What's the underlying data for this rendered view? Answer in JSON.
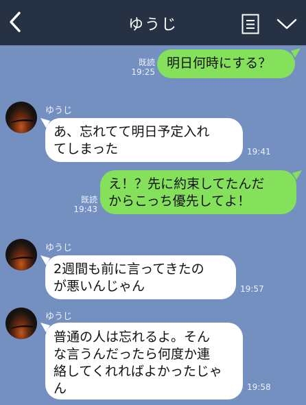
{
  "header": {
    "title": "ゆうじ",
    "icons": [
      "back-chevron-icon",
      "notes-icon",
      "chevron-down-icon"
    ]
  },
  "messages": [
    {
      "direction": "out",
      "text": "明日何時にする？",
      "read": "既読",
      "time": "19:25"
    },
    {
      "direction": "in",
      "sender": "ゆうじ",
      "lines": [
        "あ、忘れてて明日予定入れ",
        "てしまった"
      ],
      "time": "19:41"
    },
    {
      "direction": "out",
      "lines": [
        "え！？先に約束してたんだ",
        "からこっち優先してよ！"
      ],
      "read": "既読",
      "time": "19:43"
    },
    {
      "direction": "in",
      "sender": "ゆうじ",
      "lines": [
        "2週間も前に言ってきたの",
        "が悪いんじゃん"
      ],
      "time": "19:57"
    },
    {
      "direction": "in",
      "sender": "ゆうじ",
      "lines": [
        "普通の人は忘れるよ。そん",
        "な言うんだったら何度か連",
        "絡してくれればよかったじゃ",
        "ん"
      ],
      "time": "19:58"
    }
  ],
  "colors": {
    "background": "#7390c0",
    "header": "#263244",
    "outgoing_bubble": "#85e15c",
    "incoming_bubble": "#ffffff"
  }
}
